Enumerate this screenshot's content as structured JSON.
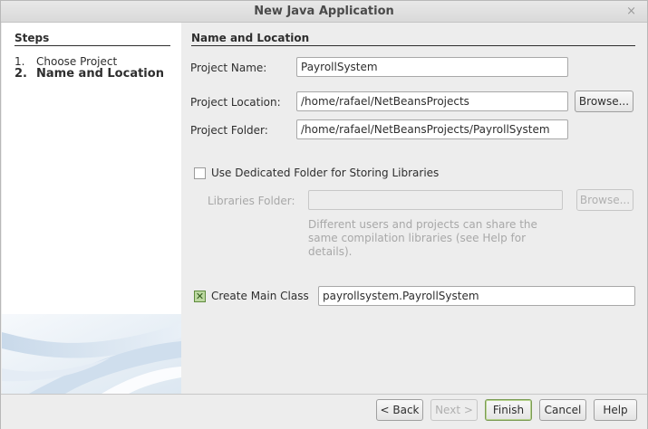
{
  "window": {
    "title": "New Java Application",
    "close_glyph": "×"
  },
  "steps": {
    "title": "Steps",
    "items": [
      {
        "num": "1.",
        "label": "Choose Project"
      },
      {
        "num": "2.",
        "label": "Name and Location"
      }
    ]
  },
  "panel": {
    "title": "Name and Location",
    "project_name": {
      "label": "Project Name:",
      "value": "PayrollSystem"
    },
    "project_location": {
      "label": "Project Location:",
      "value": "/home/rafael/NetBeansProjects",
      "browse": "Browse..."
    },
    "project_folder": {
      "label": "Project Folder:",
      "value": "/home/rafael/NetBeansProjects/PayrollSystem"
    },
    "dedicated_folder": {
      "label": "Use Dedicated Folder for Storing Libraries",
      "checked": false
    },
    "libraries_folder": {
      "label": "Libraries Folder:",
      "value": "",
      "browse": "Browse..."
    },
    "help_text": [
      "Different users and projects can share the",
      "same compilation libraries (see Help for",
      "details)."
    ],
    "create_main_class": {
      "label": "Create Main Class",
      "checked": true,
      "check_glyph": "✕",
      "value": "payrollsystem.PayrollSystem"
    }
  },
  "buttons": {
    "back": "< Back",
    "next": "Next >",
    "finish": "Finish",
    "cancel": "Cancel",
    "help": "Help"
  }
}
